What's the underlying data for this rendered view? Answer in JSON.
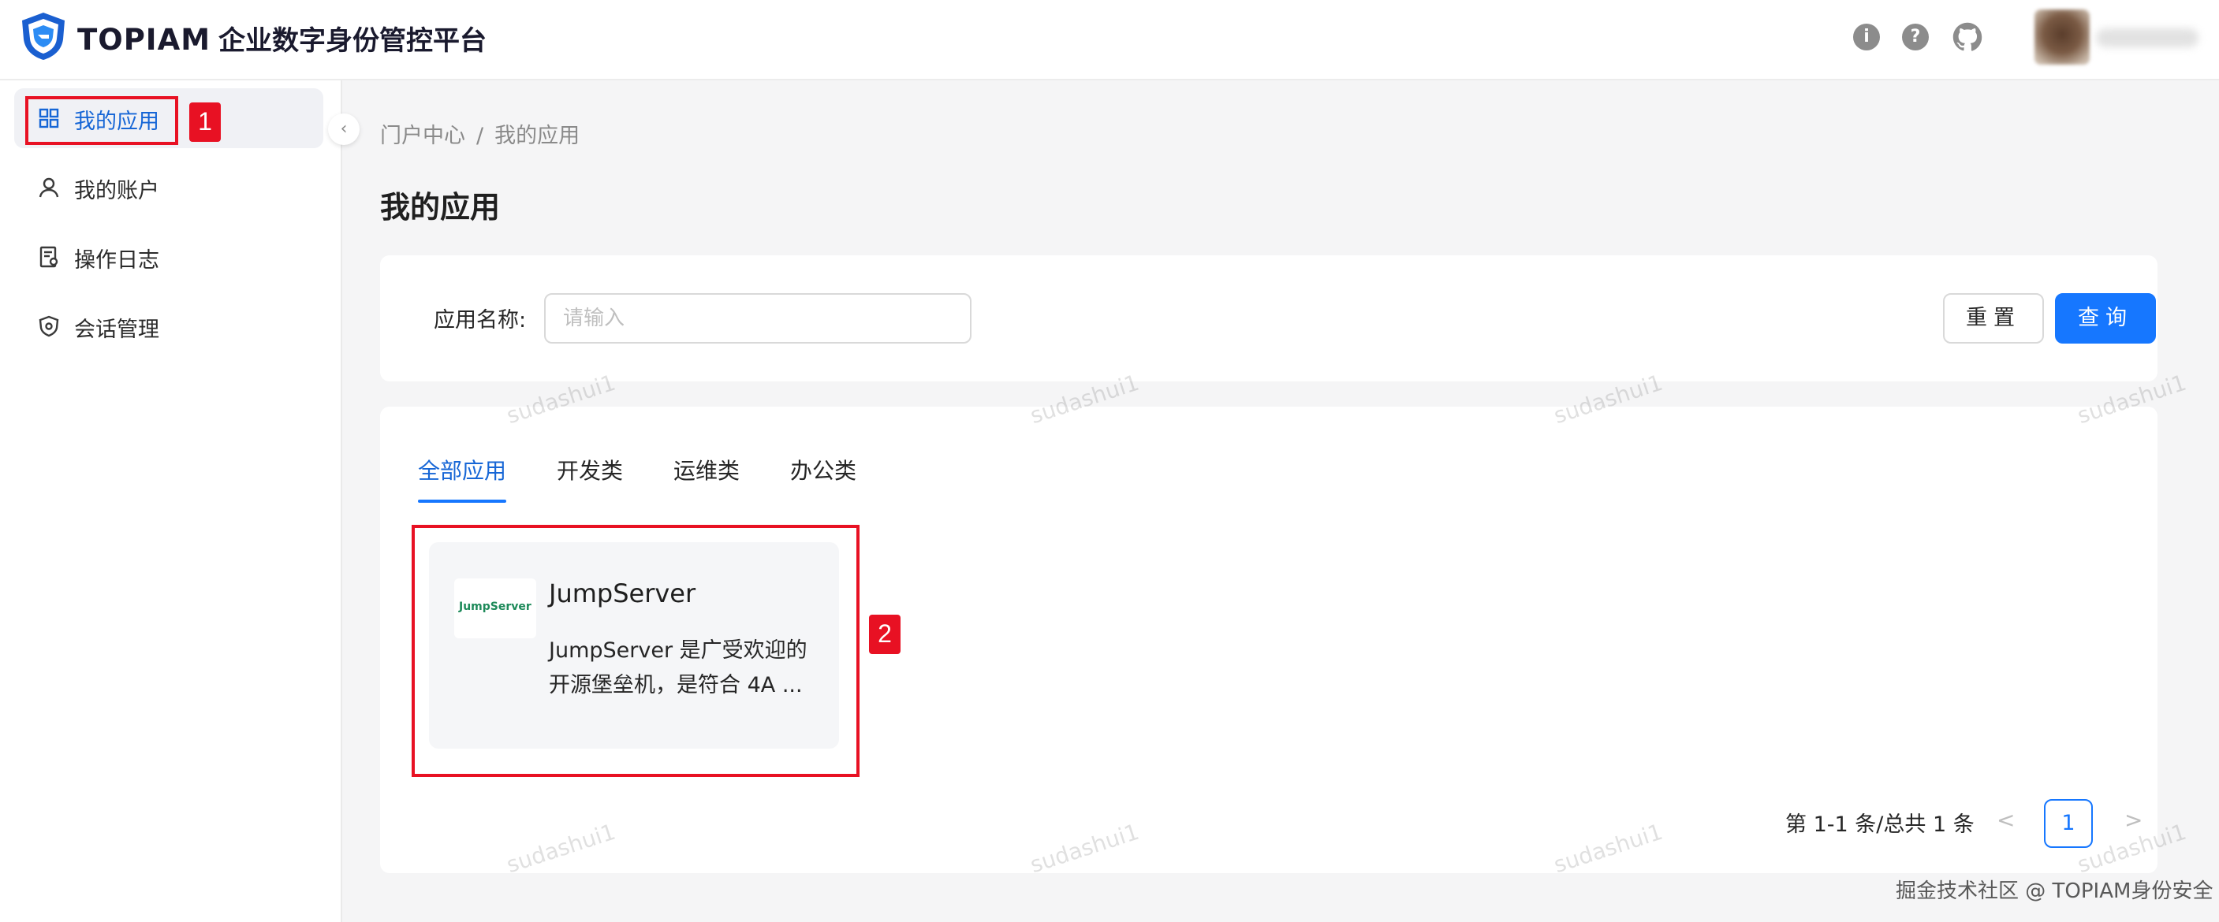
{
  "header": {
    "brand": "TOPIAM",
    "subtitle": "企业数字身份管控平台",
    "icons": [
      "info-icon",
      "help-icon",
      "github-icon"
    ],
    "info_glyph": "i",
    "help_glyph": "?"
  },
  "sidebar": {
    "items": [
      {
        "label": "我的应用",
        "icon": "apps-grid-icon",
        "active": true
      },
      {
        "label": "我的账户",
        "icon": "user-icon",
        "active": false
      },
      {
        "label": "操作日志",
        "icon": "log-icon",
        "active": false
      },
      {
        "label": "会话管理",
        "icon": "shield-icon",
        "active": false
      }
    ],
    "collapse_glyph": "‹"
  },
  "annotations": {
    "badge_1": "1",
    "badge_2": "2"
  },
  "breadcrumb": {
    "root": "门户中心",
    "separator": "/",
    "current": "我的应用"
  },
  "page_title": "我的应用",
  "search": {
    "label": "应用名称:",
    "placeholder": "请输入",
    "value": "",
    "reset_label": "重置",
    "query_label": "查询"
  },
  "tabs": [
    {
      "label": "全部应用",
      "active": true
    },
    {
      "label": "开发类",
      "active": false
    },
    {
      "label": "运维类",
      "active": false
    },
    {
      "label": "办公类",
      "active": false
    }
  ],
  "apps": [
    {
      "name": "JumpServer",
      "logo_text": "JumpServer",
      "description": "JumpServer 是广受欢迎的开源堡垒机，是符合 4A ..."
    }
  ],
  "pagination": {
    "total_text": "第 1-1 条/总共 1 条",
    "current_page": "1",
    "prev_glyph": "<",
    "next_glyph": ">"
  },
  "watermark_text": "sudashui1",
  "footer_note": "掘金技术社区 @ TOPIAM身份安全",
  "colors": {
    "accent": "#1677ff",
    "active_text": "#1666d6",
    "annotation_red": "#e81123"
  }
}
